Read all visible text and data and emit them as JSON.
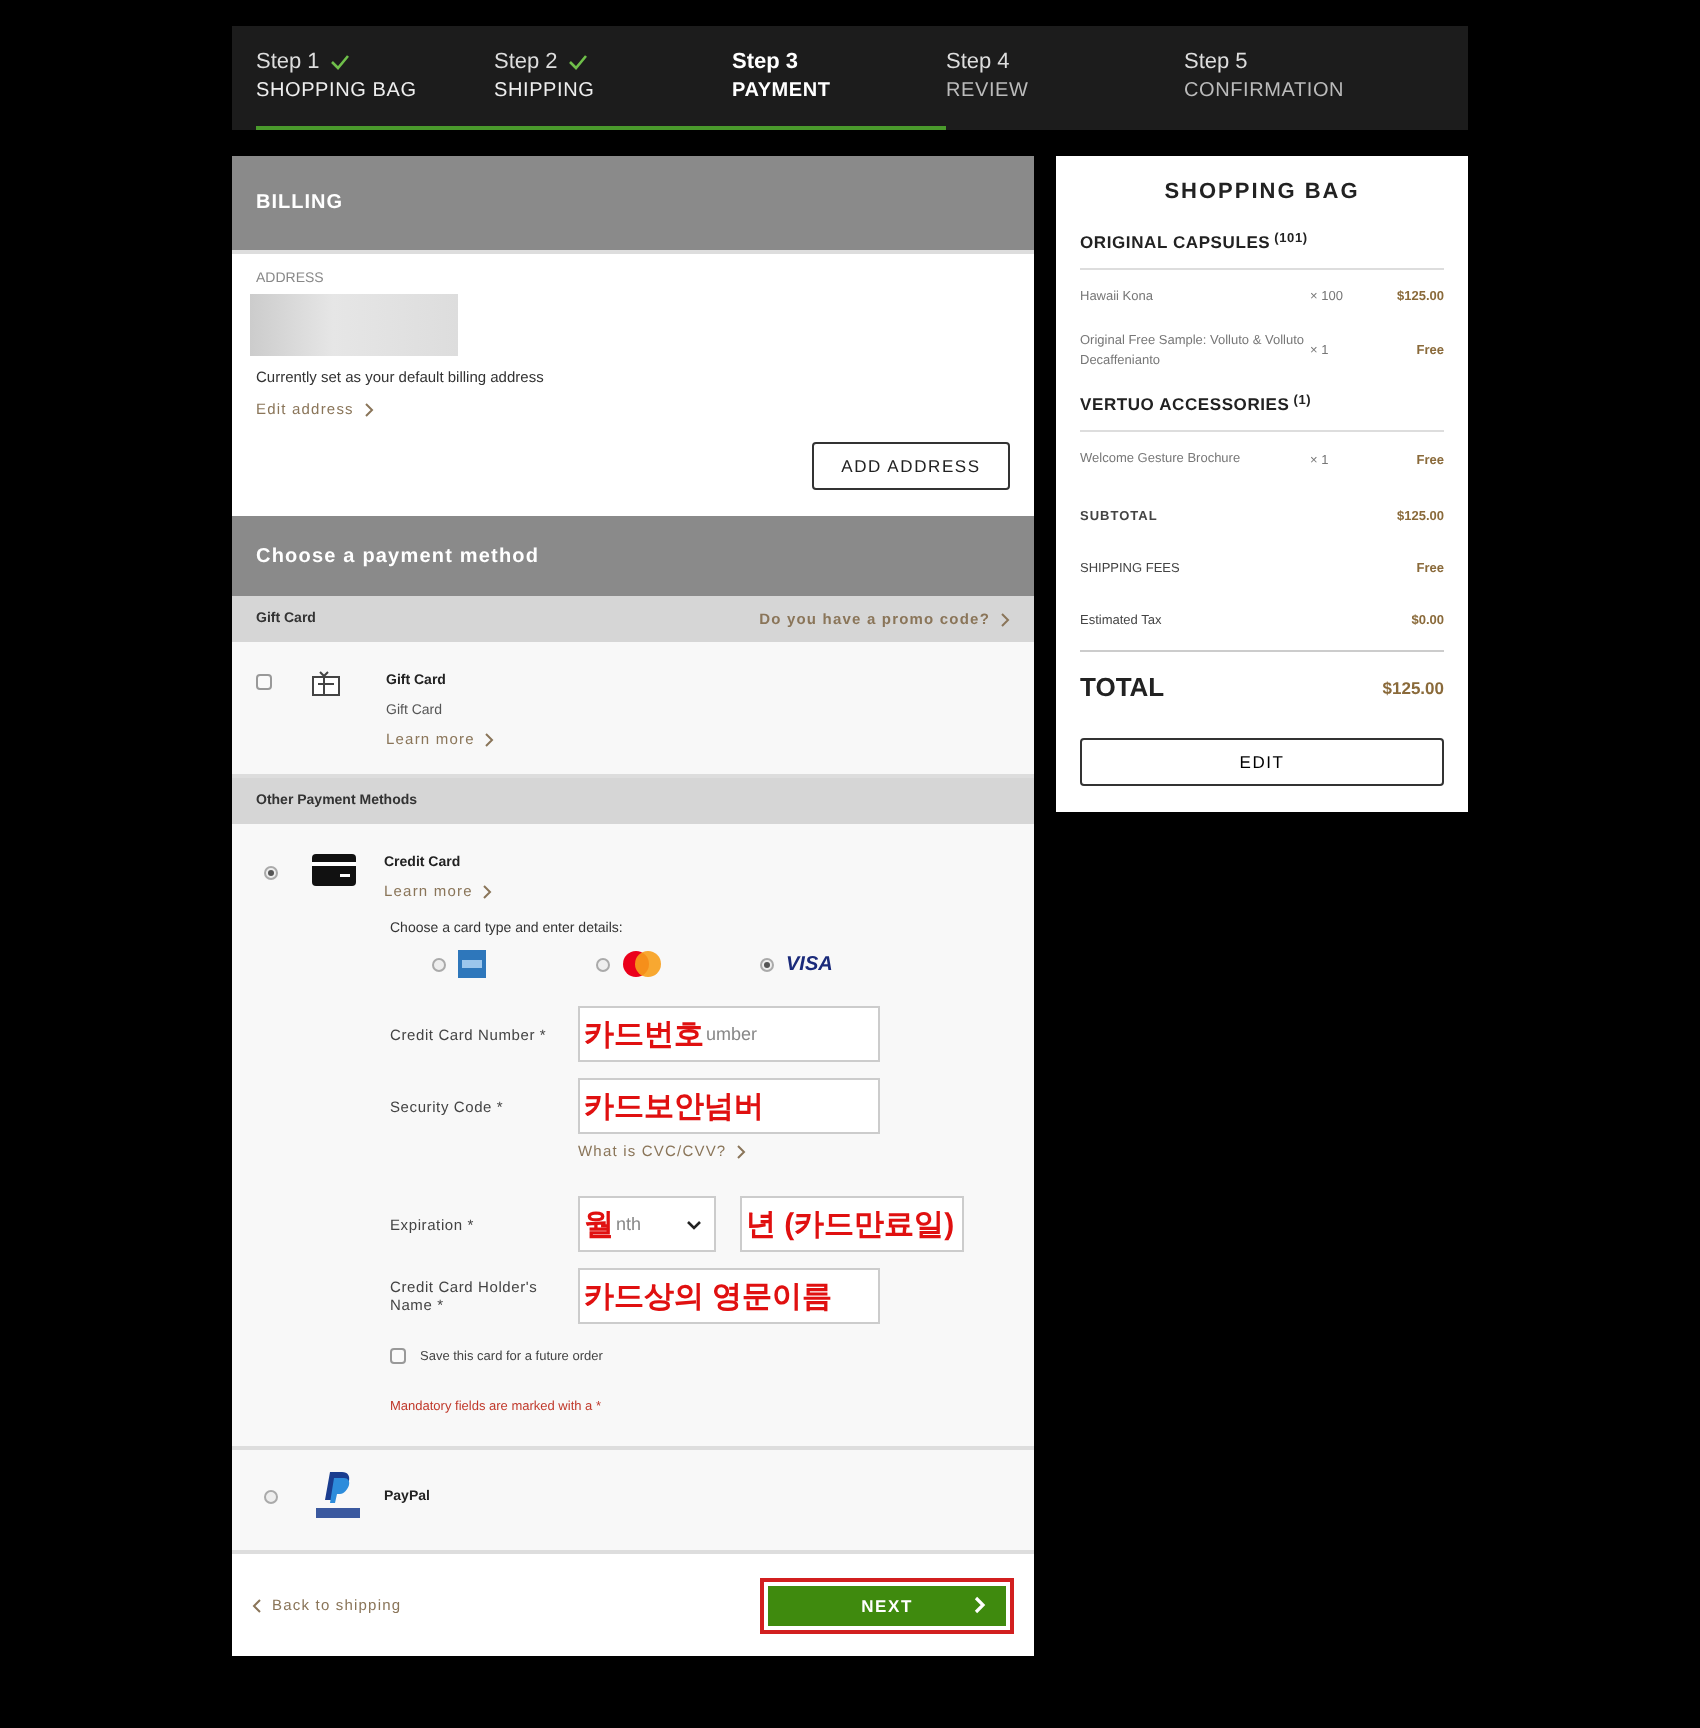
{
  "steps": [
    {
      "step": "Step 1",
      "name": "SHOPPING BAG",
      "done": true,
      "selected": false
    },
    {
      "step": "Step 2",
      "name": "SHIPPING",
      "done": true,
      "selected": false
    },
    {
      "step": "Step 3",
      "name": "PAYMENT",
      "done": false,
      "selected": true
    },
    {
      "step": "Step 4",
      "name": "REVIEW",
      "done": false,
      "selected": false
    },
    {
      "step": "Step 5",
      "name": "CONFIRMATION",
      "done": false,
      "selected": false
    }
  ],
  "billing": {
    "title": "BILLING",
    "address_label": "ADDRESS",
    "default_note": "Currently set as your default billing address",
    "edit_link": "Edit address",
    "add_button": "ADD ADDRESS"
  },
  "payment": {
    "title": "Choose a payment method",
    "gift_section": {
      "title": "Gift Card",
      "promo_link": "Do you have a promo code?",
      "option": {
        "name": "Gift Card",
        "description": "Gift Card",
        "learn_more": "Learn more",
        "checked": false
      }
    },
    "other_section": {
      "title": "Other Payment Methods"
    },
    "methods": [
      {
        "kind": "card",
        "name": "Credit Card",
        "learn_more": "Learn more",
        "selected": true
      },
      {
        "kind": "paypal",
        "name": "PayPal",
        "selected": false
      }
    ],
    "card_form": {
      "instruction": "Choose a card type and enter details:",
      "card_types": [
        {
          "kind": "amex",
          "selected": false
        },
        {
          "kind": "mastercard",
          "selected": false
        },
        {
          "kind": "visa",
          "label": "VISA",
          "selected": true
        }
      ],
      "fields": [
        {
          "kind": "text",
          "label": "Credit Card Number *",
          "annotation": "카드번호",
          "tail": "umber"
        },
        {
          "kind": "text",
          "label": "Security Code *",
          "annotation": "카드보안넘버",
          "link": "What is CVC/CVV?"
        },
        {
          "kind": "expiry",
          "label": "Expiration *",
          "parts": [
            {
              "kind": "select",
              "annotation": "월",
              "tail": "nth"
            },
            {
              "kind": "text",
              "annotation": "년 (카드만료일)"
            }
          ]
        },
        {
          "kind": "text",
          "label": "Credit Card Holder's Name *",
          "annotation": "카드상의 영문이름"
        }
      ],
      "save_card": {
        "label": "Save this card for a future order",
        "checked": false
      },
      "mandatory_note": "Mandatory fields are marked with a *"
    }
  },
  "footer": {
    "back_link": "Back to shipping",
    "next_button": "NEXT"
  },
  "bag": {
    "title": "SHOPPING BAG",
    "groups": [
      {
        "name": "ORIGINAL CAPSULES",
        "count": "(101)",
        "items": [
          {
            "name": "Hawaii Kona",
            "qty": "× 100",
            "price": "$125.00"
          },
          {
            "name": "Original Free Sample: Volluto & Volluto Decaffenianto",
            "qty": "× 1",
            "price": "Free"
          }
        ]
      },
      {
        "name": "VERTUO ACCESSORIES",
        "count": "(1)",
        "items": [
          {
            "name": "Welcome Gesture Brochure",
            "qty": "× 1",
            "price": "Free"
          }
        ]
      }
    ],
    "summary": [
      {
        "kind": "subtotal",
        "label": "SUBTOTAL",
        "value": "$125.00"
      },
      {
        "kind": "plain",
        "label": "SHIPPING FEES",
        "value": "Free"
      },
      {
        "kind": "plain",
        "label": "Estimated Tax",
        "value": "$0.00"
      }
    ],
    "total": {
      "label": "TOTAL",
      "value": "$125.00"
    },
    "edit_button": "EDIT"
  }
}
